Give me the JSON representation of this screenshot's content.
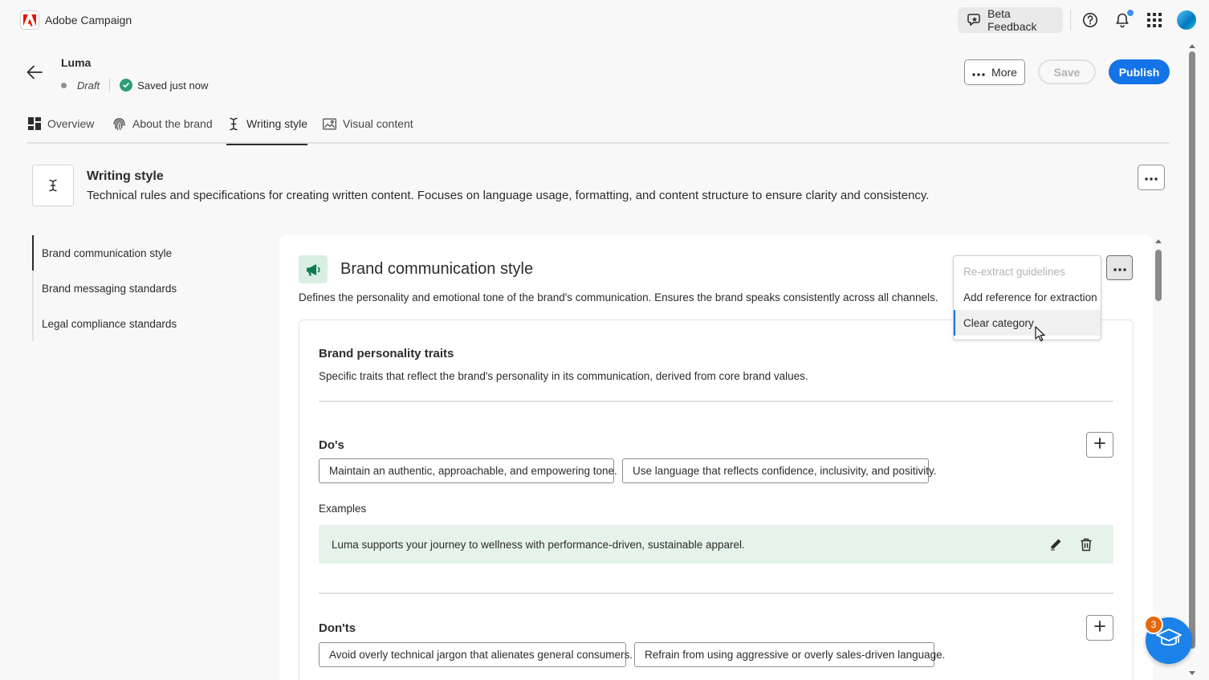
{
  "app": {
    "title": "Adobe Campaign"
  },
  "topbar": {
    "beta_feedback": "Beta Feedback"
  },
  "header": {
    "brand_name": "Luma",
    "status": "Draft",
    "saved": "Saved just now",
    "more_label": "More",
    "save_label": "Save",
    "publish_label": "Publish"
  },
  "tabs": [
    {
      "label": "Overview"
    },
    {
      "label": "About the brand"
    },
    {
      "label": "Writing style"
    },
    {
      "label": "Visual content"
    }
  ],
  "section": {
    "title": "Writing style",
    "description": "Technical rules and specifications for creating written content. Focuses on language usage, formatting, and content structure to ensure clarity and consistency."
  },
  "sidebar": {
    "items": [
      {
        "label": "Brand communication style"
      },
      {
        "label": "Brand messaging standards"
      },
      {
        "label": "Legal compliance standards"
      }
    ]
  },
  "card": {
    "title": "Brand communication style",
    "description": "Defines the personality and emotional tone of the brand's communication. Ensures the brand speaks consistently across all channels.",
    "subsection_title": "Brand personality traits",
    "subsection_desc": "Specific traits that reflect the brand's personality in its communication, derived from core brand values.",
    "dos_title": "Do's",
    "dos": [
      "Maintain an authentic, approachable, and empowering tone.",
      "Use language that reflects confidence, inclusivity, and positivity."
    ],
    "examples_label": "Examples",
    "example": "Luma supports your journey to wellness with performance-driven, sustainable apparel.",
    "donts_title": "Don'ts",
    "donts": [
      "Avoid overly technical jargon that alienates general consumers.",
      "Refrain from using aggressive or overly sales-driven language."
    ]
  },
  "menu": {
    "items": [
      {
        "label": "Re-extract guidelines"
      },
      {
        "label": "Add reference for extraction"
      },
      {
        "label": "Clear category"
      }
    ]
  },
  "learn_badge": "3",
  "colors": {
    "accent": "#1473e6",
    "success": "#2d9d78",
    "example_bg": "#e6f3ea",
    "badge": "#e3680b"
  }
}
